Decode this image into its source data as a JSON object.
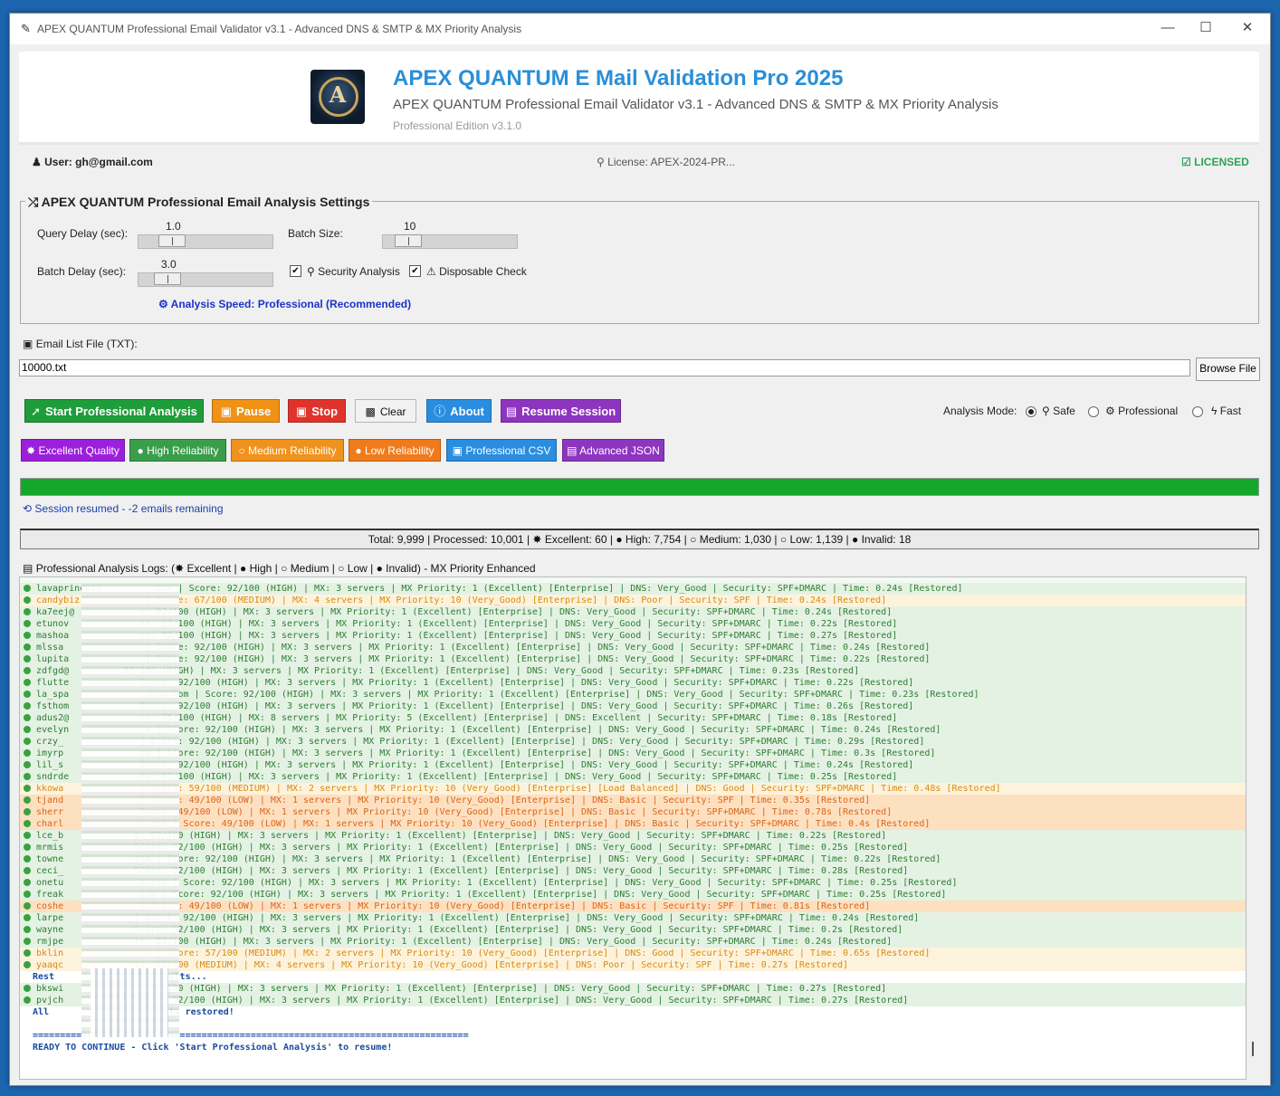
{
  "window": {
    "title": "APEX QUANTUM Professional Email Validator v3.1 - Advanced DNS & SMTP & MX Priority Analysis",
    "minimize": "—",
    "maximize": "☐",
    "close": "✕"
  },
  "header": {
    "logo_letter": "A",
    "title": "APEX QUANTUM E Mail Validation Pro 2025",
    "subtitle": "APEX QUANTUM Professional Email Validator v3.1 - Advanced DNS & SMTP & MX Priority Analysis",
    "edition": "Professional Edition v3.1.0"
  },
  "info": {
    "user": "User: gh@gmail.com",
    "license": "License: APEX-2024-PR...",
    "licensed": "LICENSED"
  },
  "settings": {
    "legend": "APEX QUANTUM Professional Email Analysis Settings",
    "query_delay_label": "Query Delay (sec):",
    "query_delay_value": "1.0",
    "batch_size_label": "Batch Size:",
    "batch_size_value": "10",
    "batch_delay_label": "Batch Delay (sec):",
    "batch_delay_value": "3.0",
    "security_label": "Security Analysis",
    "security_checked": true,
    "disposable_label": "Disposable Check",
    "disposable_checked": true,
    "speed": "Analysis Speed: Professional (Recommended)"
  },
  "file": {
    "label": "Email List File (TXT):",
    "value": "10000.txt",
    "browse": "Browse File"
  },
  "buttons": {
    "start": "Start Professional Analysis",
    "pause": "Pause",
    "stop": "Stop",
    "clear": "Clear",
    "about": "About",
    "resume": "Resume Session"
  },
  "mode": {
    "label": "Analysis Mode:",
    "safe": "Safe",
    "professional": "Professional",
    "fast": "Fast",
    "selected": "Safe"
  },
  "filters": {
    "excellent": "Excellent Quality",
    "high": "High Reliability",
    "medium": "Medium Reliability",
    "low": "Low Reliability",
    "csv": "Professional CSV",
    "json": "Advanced JSON"
  },
  "progress": {
    "percent": 100
  },
  "session_text": "Session resumed - -2 emails remaining",
  "stats": {
    "total": "Total: 9,999",
    "processed": "Processed: 10,001",
    "excellent": "Excellent: 60",
    "high": "High: 7,754",
    "medium": "Medium: 1,030",
    "low": "Low: 1,139",
    "invalid": "Invalid: 18"
  },
  "logs": {
    "label_prefix": "Professional Analysis Logs: (",
    "excellent": "Excellent |",
    "high": "High |",
    "medium": "Medium |",
    "low": "Low |",
    "invalid": "Invalid) - MX Priority Enhanced",
    "lines": [
      {
        "level": "high",
        "text": "lavaprincess         .com | Score: 92/100 (HIGH) | MX: 3 servers | MX Priority: 1 (Excellent) [Enterprise] | DNS: Very_Good | Security: SPF+DMARC | Time: 0.24s [Restored]"
      },
      {
        "level": "med",
        "text": "candybiz            | Score: 67/100 (MEDIUM) | MX: 4 servers | MX Priority: 10 (Very_Good) [Enterprise] | DNS: Poor | Security: SPF | Time: 0.24s [Restored]"
      },
      {
        "level": "high",
        "text": "ka7eej@            e: 92/100 (HIGH) | MX: 3 servers | MX Priority: 1 (Excellent) [Enterprise] | DNS: Very_Good | Security: SPF+DMARC | Time: 0.24s [Restored]"
      },
      {
        "level": "high",
        "text": "etunov             re: 92/100 (HIGH) | MX: 3 servers | MX Priority: 1 (Excellent) [Enterprise] | DNS: Very_Good | Security: SPF+DMARC | Time: 0.22s [Restored]"
      },
      {
        "level": "high",
        "text": "mashoa             re: 92/100 (HIGH) | MX: 3 servers | MX Priority: 1 (Excellent) [Enterprise] | DNS: Very_Good | Security: SPF+DMARC | Time: 0.27s [Restored]"
      },
      {
        "level": "high",
        "text": "mlssa               | Score: 92/100 (HIGH) | MX: 3 servers | MX Priority: 1 (Excellent) [Enterprise] | DNS: Very_Good | Security: SPF+DMARC | Time: 0.24s [Restored]"
      },
      {
        "level": "high",
        "text": "lupita              | Score: 92/100 (HIGH) | MX: 3 servers | MX Priority: 1 (Excellent) [Enterprise] | DNS: Very_Good | Security: SPF+DMARC | Time: 0.22s [Restored]"
      },
      {
        "level": "high",
        "text": "zdfgd@          92/100 (HIGH) | MX: 3 servers | MX Priority: 1 (Excellent) [Enterprise] | DNS: Very_Good | Security: SPF+DMARC | Time: 0.23s [Restored]"
      },
      {
        "level": "high",
        "text": "flutte             Score: 92/100 (HIGH) | MX: 3 servers | MX Priority: 1 (Excellent) [Enterprise] | DNS: Very_Good | Security: SPF+DMARC | Time: 0.22s [Restored]"
      },
      {
        "level": "high",
        "text": "la_spa              ahoo.com | Score: 92/100 (HIGH) | MX: 3 servers | MX Priority: 1 (Excellent) [Enterprise] | DNS: Very_Good | Security: SPF+DMARC | Time: 0.23s [Restored]"
      },
      {
        "level": "high",
        "text": "fsthom             Score: 92/100 (HIGH) | MX: 3 servers | MX Priority: 1 (Excellent) [Enterprise] | DNS: Very_Good | Security: SPF+DMARC | Time: 0.26s [Restored]"
      },
      {
        "level": "high",
        "text": "adus2@             re: 75/100 (HIGH) | MX: 8 servers | MX Priority: 5 (Excellent) [Enterprise] | DNS: Excellent | Security: SPF+DMARC | Time: 0.18s [Restored]"
      },
      {
        "level": "high",
        "text": "evelyn              m | Score: 92/100 (HIGH) | MX: 3 servers | MX Priority: 1 (Excellent) [Enterprise] | DNS: Very_Good | Security: SPF+DMARC | Time: 0.24s [Restored]"
      },
      {
        "level": "high",
        "text": "crzy_              | Score: 92/100 (HIGH) | MX: 3 servers | MX Priority: 1 (Excellent) [Enterprise] | DNS: Very_Good | Security: SPF+DMARC | Time: 0.29s [Restored]"
      },
      {
        "level": "high",
        "text": "imyrp              om | Score: 92/100 (HIGH) | MX: 3 servers | MX Priority: 1 (Excellent) [Enterprise] | DNS: Very_Good | Security: SPF+DMARC | Time: 0.3s [Restored]"
      },
      {
        "level": "high",
        "text": "lil_s              Score: 92/100 (HIGH) | MX: 3 servers | MX Priority: 1 (Excellent) [Enterprise] | DNS: Very_Good | Security: SPF+DMARC | Time: 0.24s [Restored]"
      },
      {
        "level": "high",
        "text": "sndrde             re: 92/100 (HIGH) | MX: 3 servers | MX Priority: 1 (Excellent) [Enterprise] | DNS: Very_Good | Security: SPF+DMARC | Time: 0.25s [Restored]"
      },
      {
        "level": "med",
        "text": "kkowa              | Score: 59/100 (MEDIUM) | MX: 2 servers | MX Priority: 10 (Very_Good) [Enterprise] [Load Balanced] | DNS: Good | Security: SPF+DMARC | Time: 0.48s [Restored]"
      },
      {
        "level": "low",
        "text": "tjand              | Score: 49/100 (LOW) | MX: 1 servers | MX Priority: 10 (Very_Good) [Enterprise] | DNS: Basic | Security: SPF | Time: 0.35s [Restored]"
      },
      {
        "level": "low",
        "text": "sherr              Score: 49/100 (LOW) | MX: 1 servers | MX Priority: 10 (Very_Good) [Enterprise] | DNS: Basic | Security: SPF+DMARC | Time: 0.78s [Restored]"
      },
      {
        "level": "low",
        "text": "charl              n.net | Score: 49/100 (LOW) | MX: 1 servers | MX Priority: 10 (Very_Good) [Enterprise] | DNS: Basic | Security: SPF+DMARC | Time: 0.4s [Restored]"
      },
      {
        "level": "high",
        "text": "lce_b             e: 92/100 (HIGH) | MX: 3 servers | MX Priority: 1 (Excellent) [Enterprise] | DNS: Very_Good | Security: SPF+DMARC | Time: 0.22s [Restored]"
      },
      {
        "level": "high",
        "text": "mrmis             Score: 92/100 (HIGH) | MX: 3 servers | MX Priority: 1 (Excellent) [Enterprise] | DNS: Very_Good | Security: SPF+DMARC | Time: 0.25s [Restored]"
      },
      {
        "level": "high",
        "text": "towne             com | Score: 92/100 (HIGH) | MX: 3 servers | MX Priority: 1 (Excellent) [Enterprise] | DNS: Very_Good | Security: SPF+DMARC | Time: 0.22s [Restored]"
      },
      {
        "level": "high",
        "text": "ceci_             Score: 92/100 (HIGH) | MX: 3 servers | MX Priority: 1 (Excellent) [Enterprise] | DNS: Very_Good | Security: SPF+DMARC | Time: 0.28s [Restored]"
      },
      {
        "level": "high",
        "text": "onetu              o.com | Score: 92/100 (HIGH) | MX: 3 servers | MX Priority: 1 (Excellent) [Enterprise] | DNS: Very_Good | Security: SPF+DMARC | Time: 0.25s [Restored]"
      },
      {
        "level": "high",
        "text": "freak             .com | Score: 92/100 (HIGH) | MX: 3 servers | MX Priority: 1 (Excellent) [Enterprise] | DNS: Very_Good | Security: SPF+DMARC | Time: 0.25s [Restored]"
      },
      {
        "level": "low",
        "text": "coshe              | Score: 49/100 (LOW) | MX: 1 servers | MX Priority: 10 (Very_Good) [Enterprise] | DNS: Basic | Security: SPF | Time: 0.81s [Restored]"
      },
      {
        "level": "high",
        "text": "larpe             | Score: 92/100 (HIGH) | MX: 3 servers | MX Priority: 1 (Excellent) [Enterprise] | DNS: Very_Good | Security: SPF+DMARC | Time: 0.24s [Restored]"
      },
      {
        "level": "high",
        "text": "wayne             Score: 92/100 (HIGH) | MX: 3 servers | MX Priority: 1 (Excellent) [Enterprise] | DNS: Very_Good | Security: SPF+DMARC | Time: 0.2s [Restored]"
      },
      {
        "level": "high",
        "text": "rmjpe             re: 92/100 (HIGH) | MX: 3 servers | MX Priority: 1 (Excellent) [Enterprise] | DNS: Very_Good | Security: SPF+DMARC | Time: 0.24s [Restored]"
      },
      {
        "level": "med",
        "text": "bklin              om | Score: 57/100 (MEDIUM) | MX: 2 servers | MX Priority: 10 (Very_Good) [Enterprise] | DNS: Good | Security: SPF+DMARC | Time: 0.65s [Restored]"
      },
      {
        "level": "med",
        "text": "yaaqc             re: 67/100 (MEDIUM) | MX: 4 servers | MX Priority: 10 (Very_Good) [Enterprise] | DNS: Poor | Security: SPF | Time: 0.27s [Restored]"
      },
      {
        "level": "plain",
        "text": "Rest             ,001 results..."
      },
      {
        "level": "high",
        "text": "bkswi             e: 92/100 (HIGH) | MX: 3 servers | MX Priority: 1 (Excellent) [Enterprise] | DNS: Very_Good | Security: SPF+DMARC | Time: 0.27s [Restored]"
      },
      {
        "level": "high",
        "text": "pvjch             Score: 92/100 (HIGH) | MX: 3 servers | MX Priority: 1 (Excellent) [Enterprise] | DNS: Very_Good | Security: SPF+DMARC | Time: 0.27s [Restored]"
      },
      {
        "level": "plain",
        "text": "All              us results restored!"
      },
      {
        "level": "plain",
        "text": ""
      },
      {
        "level": "plain",
        "text": "================================================================================"
      },
      {
        "level": "plain",
        "text": "READY TO CONTINUE - Click 'Start Professional Analysis' to resume!"
      }
    ]
  }
}
